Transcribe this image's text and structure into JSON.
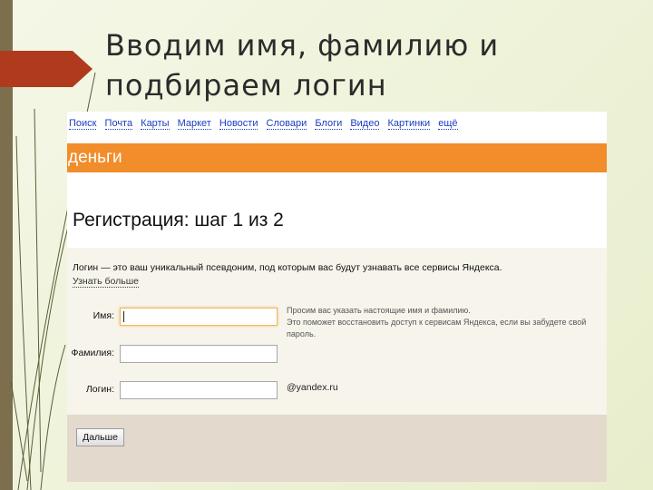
{
  "slide": {
    "title_line1": "Вводим имя, фамилию и",
    "title_line2": "подбираем логин"
  },
  "nav": {
    "links": [
      "Поиск",
      "Почта",
      "Карты",
      "Маркет",
      "Новости",
      "Словари",
      "Блоги",
      "Видео",
      "Картинки",
      "ещё"
    ]
  },
  "service": {
    "name": "деньги"
  },
  "page": {
    "heading": "Регистрация: шаг 1 из 2"
  },
  "form": {
    "intro": "Логин — это ваш уникальный псевдоним, под которым вас будут узнавать все сервисы Яндекса.",
    "learn_more": "Узнать больше",
    "name_label": "Имя:",
    "surname_label": "Фамилия:",
    "login_label": "Логин:",
    "hint_line1": "Просим вас указать настоящие имя и фамилию.",
    "hint_line2": "Это поможет восстановить доступ к сервисам Яндекса, если вы забудете свой пароль.",
    "login_suffix": "@yandex.ru",
    "next_button": "Дальше"
  },
  "colors": {
    "accent": "#f18d2a",
    "slide_marker": "#b03a1e",
    "link": "#1a3dc1"
  }
}
